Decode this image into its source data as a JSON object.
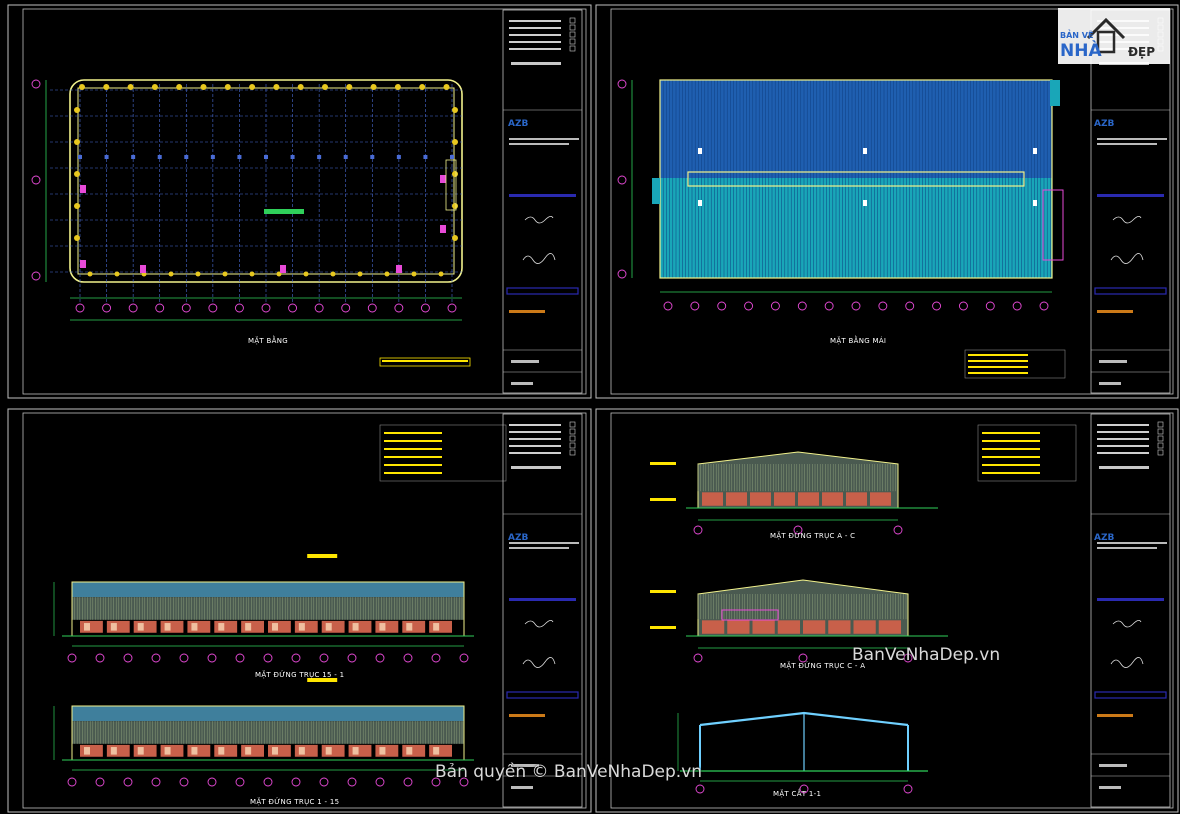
{
  "sheets": [
    {
      "id": "plan",
      "title": "MẶT BẰNG"
    },
    {
      "id": "roof",
      "title": "MẶT BẰNG MÁI"
    },
    {
      "id": "elev1",
      "title": "MẶT ĐỨNG TRỤC 15 - 1"
    },
    {
      "id": "elev2",
      "title": "MẶT ĐỨNG TRỤC 1 - 15"
    },
    {
      "id": "elev3",
      "title": "MẶT ĐỨNG TRỤC A - C"
    },
    {
      "id": "elev4",
      "title": "MẶT ĐỨNG TRỤC C - A"
    },
    {
      "id": "section",
      "title": "MẶT CẮT 1-1"
    }
  ],
  "title_block": {
    "company_mark": "AZB"
  },
  "logo": {
    "line1": "BẢN VẼ",
    "nha": "NHÀ",
    "dep": "ĐẸP"
  },
  "watermarks": {
    "site": "BanVeNhaDep.vn",
    "copyright": "Bản quyền © BanVeNhaDep.vn"
  },
  "colors": {
    "background": "#000000",
    "frame": "#bfbfbf",
    "wall": "#f2f28c",
    "grid": "#4a6cd6",
    "roof_blue": "#1f5fb0",
    "roof_cyan": "#19a6b8",
    "column": "#e84ad8",
    "tree": "#e8c81e",
    "green": "#2fd05a",
    "brick": "#c8604a",
    "accent": "#ffe600"
  }
}
